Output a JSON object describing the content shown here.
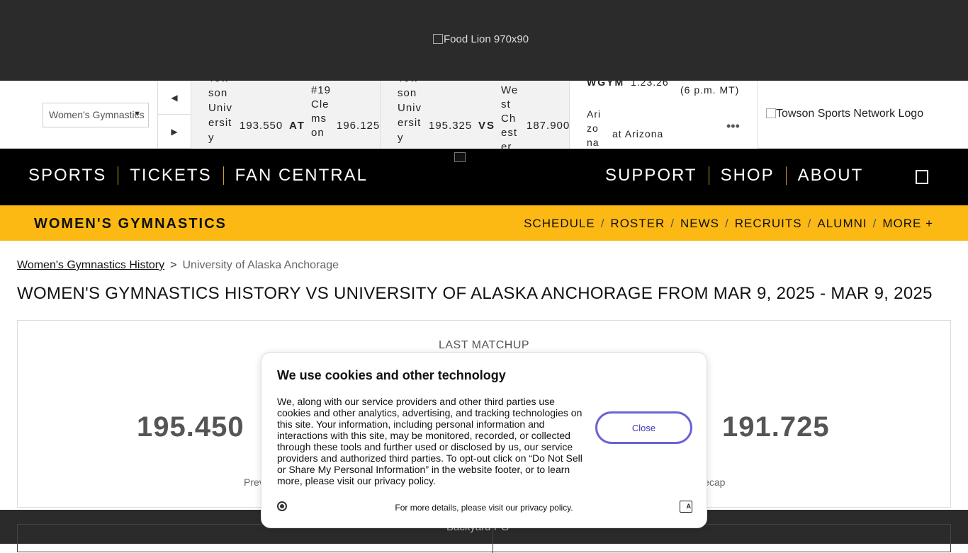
{
  "ad": {
    "alt": "Food Lion 970x90"
  },
  "scoreboard": {
    "sport_select": "Women's Gymnastics",
    "games": [
      {
        "team": "Towson University",
        "score": "193.550",
        "connector": "AT",
        "opponent": "#19 Clemson",
        "opp_score": "196.125"
      },
      {
        "team": "Towson University",
        "score": "195.325",
        "connector": "VS",
        "opponent": "West Chester",
        "opp_score": "187.900"
      }
    ],
    "upcoming": {
      "label": "WGYM",
      "date": "1.23.26",
      "time": "(6 p.m. MT)",
      "opponent_logo": "Arizona",
      "vs_text": "at Arizona"
    },
    "network_logo_alt": "Towson Sports Network Logo"
  },
  "nav": {
    "left": [
      "SPORTS",
      "TICKETS",
      "FAN CENTRAL"
    ],
    "right": [
      "SUPPORT",
      "SHOP",
      "ABOUT"
    ]
  },
  "subnav": {
    "title": "WOMEN'S GYMNASTICS",
    "links": [
      "SCHEDULE",
      "ROSTER",
      "NEWS",
      "RECRUITS",
      "ALUMNI",
      "MORE +"
    ]
  },
  "breadcrumb": {
    "parent": "Women's Gymnastics History",
    "current": "University of Alaska Anchorage"
  },
  "page_title": "WOMEN'S GYMNASTICS HISTORY VS UNIVERSITY OF ALASKA ANCHORAGE FROM MAR 9, 2025 - MAR 9, 2025",
  "matchup": {
    "label": "LAST MATCHUP",
    "home_score": "195.450",
    "away_score": "191.725",
    "preview": "Preview",
    "recap": "Recap"
  },
  "footer_ad": {
    "alt": "Backyard PG"
  },
  "cookie": {
    "title": "We use cookies and other technology",
    "body": "We, along with our service providers and other third parties use cookies and other analytics, advertising, and tracking technologies on this site. Your information, including personal information and interactions with this site, may be monitored, recorded, or collected through these tools and further used or disclosed by us, our service providers and authorized third parties. To opt-out click on “Do Not Sell or Share My Personal Information” in the website footer, or to learn more, please visit our privacy policy.",
    "close_label": "Close",
    "details": "For more details, please visit our privacy policy."
  }
}
